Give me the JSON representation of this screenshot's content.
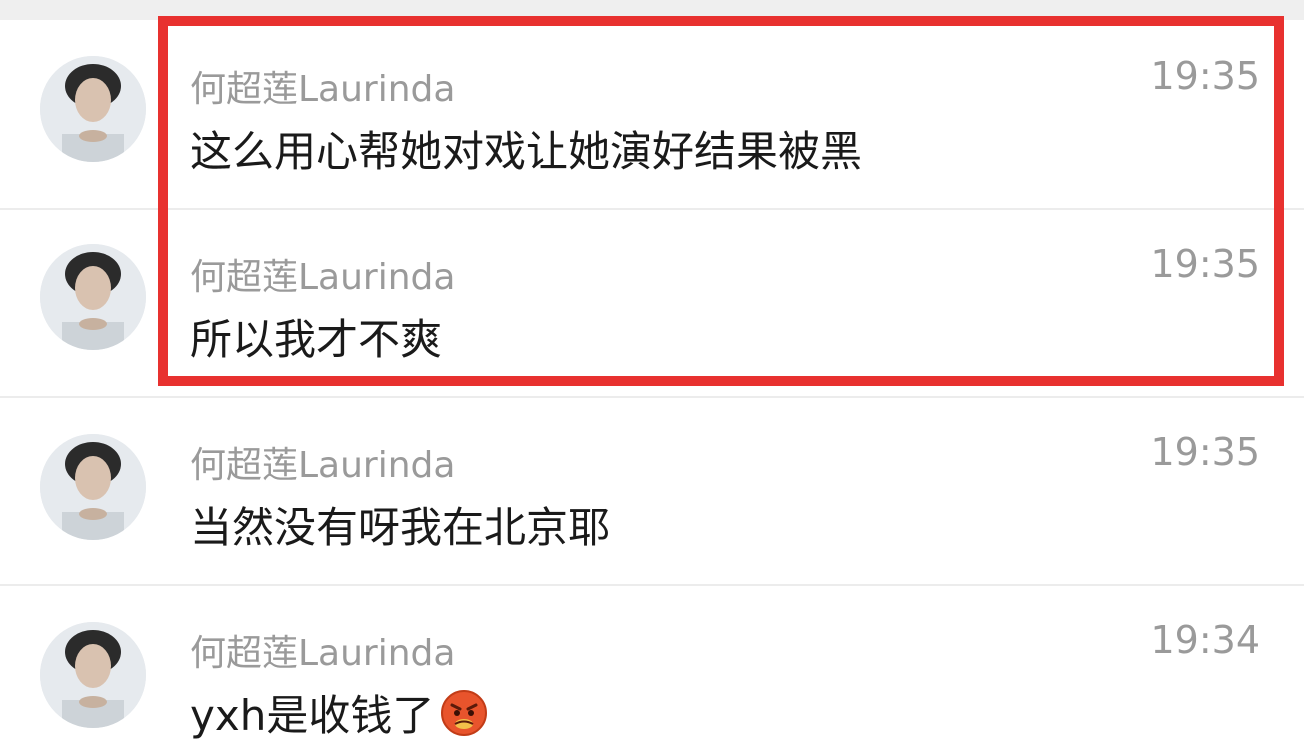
{
  "chat": {
    "messages": [
      {
        "sender": "何超莲Laurinda",
        "time": "19:35",
        "text": "这么用心帮她对戏让她演好结果被黑",
        "emoji": ""
      },
      {
        "sender": "何超莲Laurinda",
        "time": "19:35",
        "text": "所以我才不爽",
        "emoji": ""
      },
      {
        "sender": "何超莲Laurinda",
        "time": "19:35",
        "text": "当然没有呀我在北京耶",
        "emoji": ""
      },
      {
        "sender": "何超莲Laurinda",
        "time": "19:34",
        "text": "yxh是收钱了",
        "emoji": "angry-face-emoji"
      }
    ]
  },
  "colors": {
    "highlight_border": "#e8312f",
    "secondary_text": "#9a9a9a",
    "primary_text": "#1a1a1a",
    "divider": "#ececec"
  },
  "icons": {
    "avatar": "avatar-photo",
    "emoji": "angry-face-emoji"
  }
}
